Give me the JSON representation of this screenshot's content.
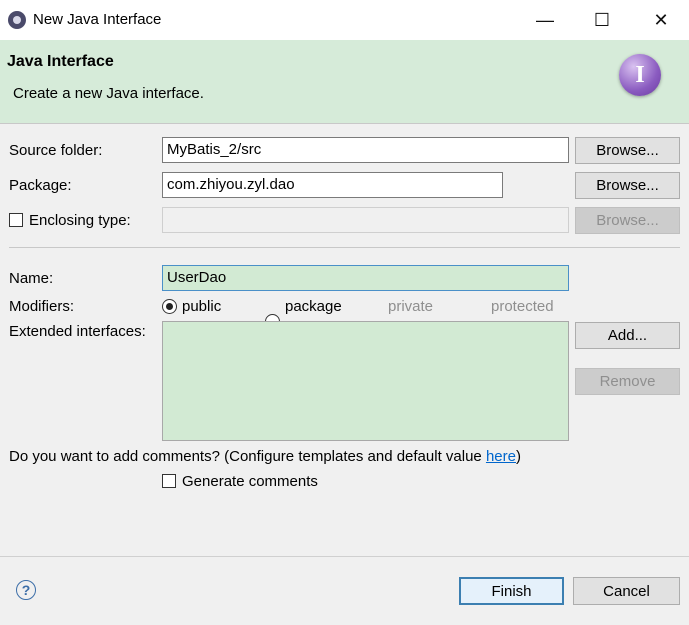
{
  "window": {
    "title": "New Java Interface",
    "minimize_glyph": "—",
    "maximize_glyph": "☐",
    "close_glyph": "✕"
  },
  "banner": {
    "title": "Java Interface",
    "subtitle": "Create a new Java interface.",
    "icon_letter": "I"
  },
  "form": {
    "source_folder": {
      "label": "Source folder:",
      "value": "MyBatis_2/src",
      "browse_label": "Browse..."
    },
    "package": {
      "label": "Package:",
      "value": "com.zhiyou.zyl.dao",
      "browse_label": "Browse..."
    },
    "enclosing_type": {
      "label": "Enclosing type:",
      "value": "",
      "browse_label": "Browse...",
      "checked": false
    },
    "name": {
      "label": "Name:",
      "value": "UserDao"
    },
    "modifiers": {
      "label": "Modifiers:",
      "options": [
        {
          "label": "public",
          "selected": true,
          "enabled": true
        },
        {
          "label": "package",
          "selected": false,
          "enabled": true
        },
        {
          "label": "private",
          "selected": false,
          "enabled": false
        },
        {
          "label": "protected",
          "selected": false,
          "enabled": false
        }
      ]
    },
    "extended_interfaces": {
      "label": "Extended interfaces:",
      "add_label": "Add...",
      "remove_label": "Remove"
    },
    "comments": {
      "question_prefix": "Do you want to add comments? (Configure templates and default value ",
      "link_text": "here",
      "question_suffix": ")",
      "generate_label": "Generate comments",
      "generate_checked": false
    }
  },
  "footer": {
    "help_glyph": "?",
    "finish_label": "Finish",
    "cancel_label": "Cancel"
  }
}
